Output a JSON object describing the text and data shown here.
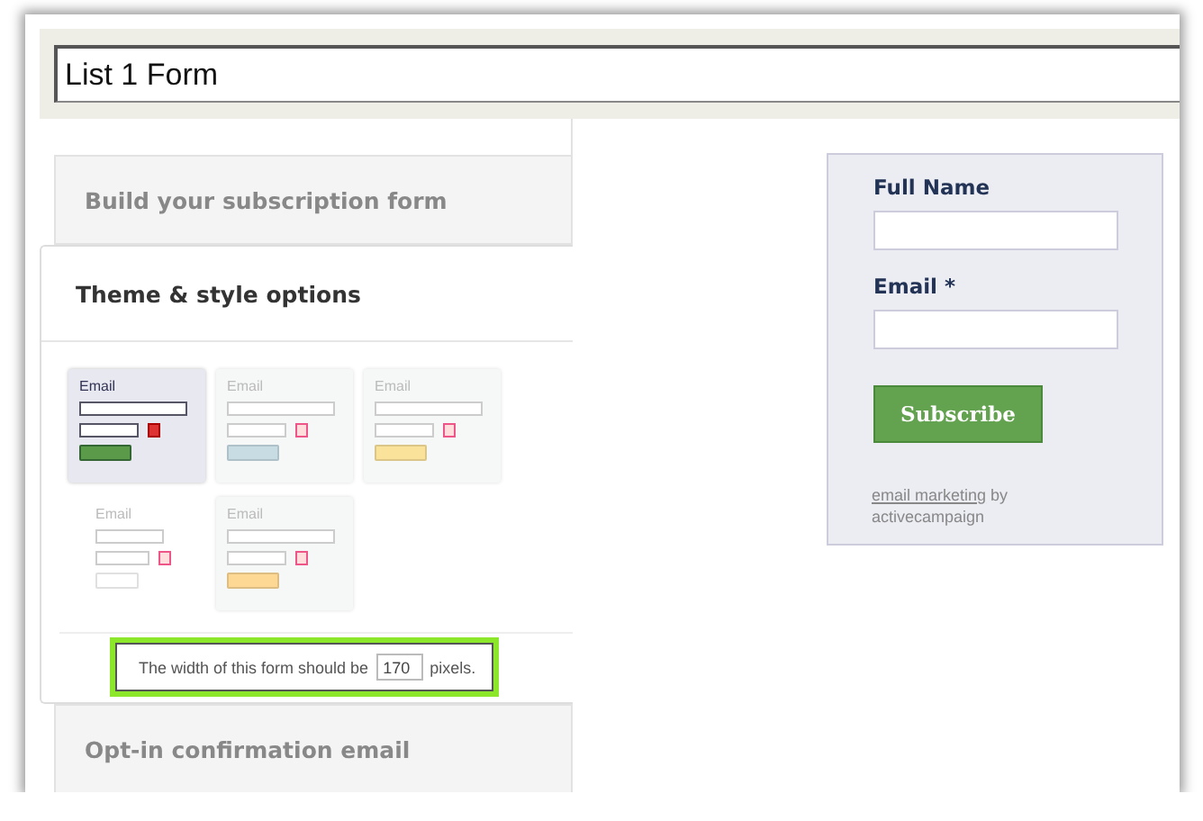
{
  "form_name": {
    "value": "List 1 Form"
  },
  "sections": [
    {
      "title": "Build your subscription form",
      "expanded": false
    },
    {
      "title": "Theme & style options",
      "expanded": true,
      "themes": [
        {
          "label": "Email",
          "selected": true,
          "kind": "card",
          "color": "#5a9a48"
        },
        {
          "label": "Email",
          "selected": false,
          "kind": "card",
          "color": "#c8dce4"
        },
        {
          "label": "Email",
          "selected": false,
          "kind": "card",
          "color": "#fbe29a"
        },
        {
          "label": "Email",
          "selected": false,
          "kind": "plain",
          "color": "#ffffff"
        },
        {
          "label": "Email",
          "selected": false,
          "kind": "card",
          "color": "#fcd894"
        }
      ],
      "width_setting": {
        "before": "The width of this form should be",
        "value": "170",
        "after": "pixels."
      }
    },
    {
      "title": "Opt-in confirmation email",
      "expanded": false
    }
  ],
  "preview": {
    "fields": [
      {
        "label": "Full Name"
      },
      {
        "label": "Email *"
      }
    ],
    "button": "Subscribe",
    "footer_link": "email marketing",
    "footer_text": " by activecampaign"
  }
}
